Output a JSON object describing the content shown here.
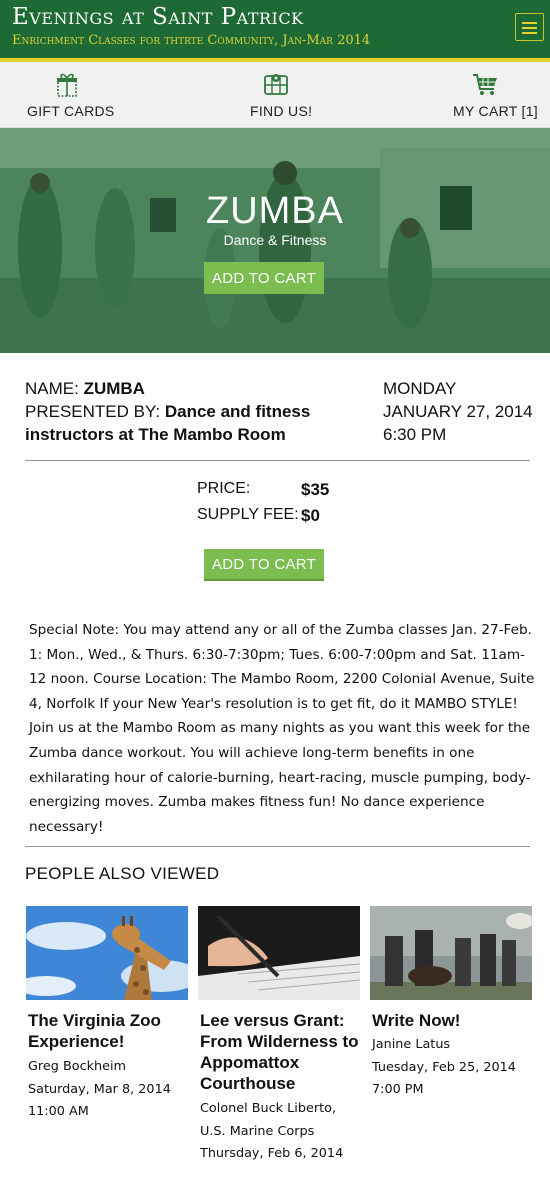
{
  "header": {
    "title": "Evenings at Saint Patrick",
    "subtitle": "Enrichment Classes for thtrte Community, Jan-Mar 2014"
  },
  "util_nav": {
    "gift_cards": {
      "label": "GIFT CARDS",
      "icon": "gift-icon"
    },
    "find_us": {
      "label": "FIND US!",
      "icon": "map-icon"
    },
    "my_cart": {
      "label": "MY CART [1]",
      "icon": "cart-icon"
    }
  },
  "hero": {
    "title": "ZUMBA",
    "subtitle": "Dance & Fitness",
    "button": "ADD TO CART"
  },
  "details": {
    "name_label": "NAME:",
    "name_value": "ZUMBA",
    "presenter_label": "PRESENTED BY:",
    "presenter_value": "Dance and fitness instructors at The Mambo Room",
    "day": "MONDAY",
    "date": "JANUARY 27, 2014",
    "time": "6:30 PM"
  },
  "pricing": {
    "price_label": "PRICE:",
    "price_value": "$35",
    "supply_label": "SUPPLY FEE:",
    "supply_value": "$0",
    "button": "ADD TO CART"
  },
  "description": "Special Note: You may attend any or all of the Zumba classes Jan. 27-Feb. 1: Mon., Wed., & Thurs. 6:30-7:30pm; Tues. 6:00-7:00pm and Sat. 11am-12 noon. Course Location: The Mambo Room, 2200 Colonial Avenue, Suite 4, Norfolk If your New Year's resolution is to get fit, do it MAMBO STYLE! Join us at the Mambo Room as many nights as you want this week for the Zumba dance workout. You will achieve long-term benefits in one exhilarating hour of calorie-burning, heart-racing, muscle pumping, body-energizing moves. Zumba makes fitness fun! No dance experience necessary!",
  "also_viewed": {
    "title": "PEOPLE ALSO VIEWED",
    "items": [
      {
        "title": "The Virginia Zoo Experience!",
        "presenter": "Greg Bockheim",
        "date": "Saturday, Mar 8, 2014",
        "time": "11:00 AM",
        "image": "giraffe"
      },
      {
        "title": "Lee versus Grant: From Wilderness to Appomattox Courthouse",
        "presenter": "Colonel Buck Liberto, U.S. Marine Corps",
        "date": "Thursday, Feb 6, 2014",
        "time": "",
        "image": "hand-writing"
      },
      {
        "title": "Write Now!",
        "presenter": "Janine Latus",
        "date": "Tuesday, Feb 25, 2014",
        "time": "7:00 PM",
        "image": "civil-war-reenactment"
      }
    ]
  },
  "colors": {
    "header_green": "#1e6a35",
    "accent_yellow": "#e6d22a",
    "button_green": "#7bbd4e"
  }
}
